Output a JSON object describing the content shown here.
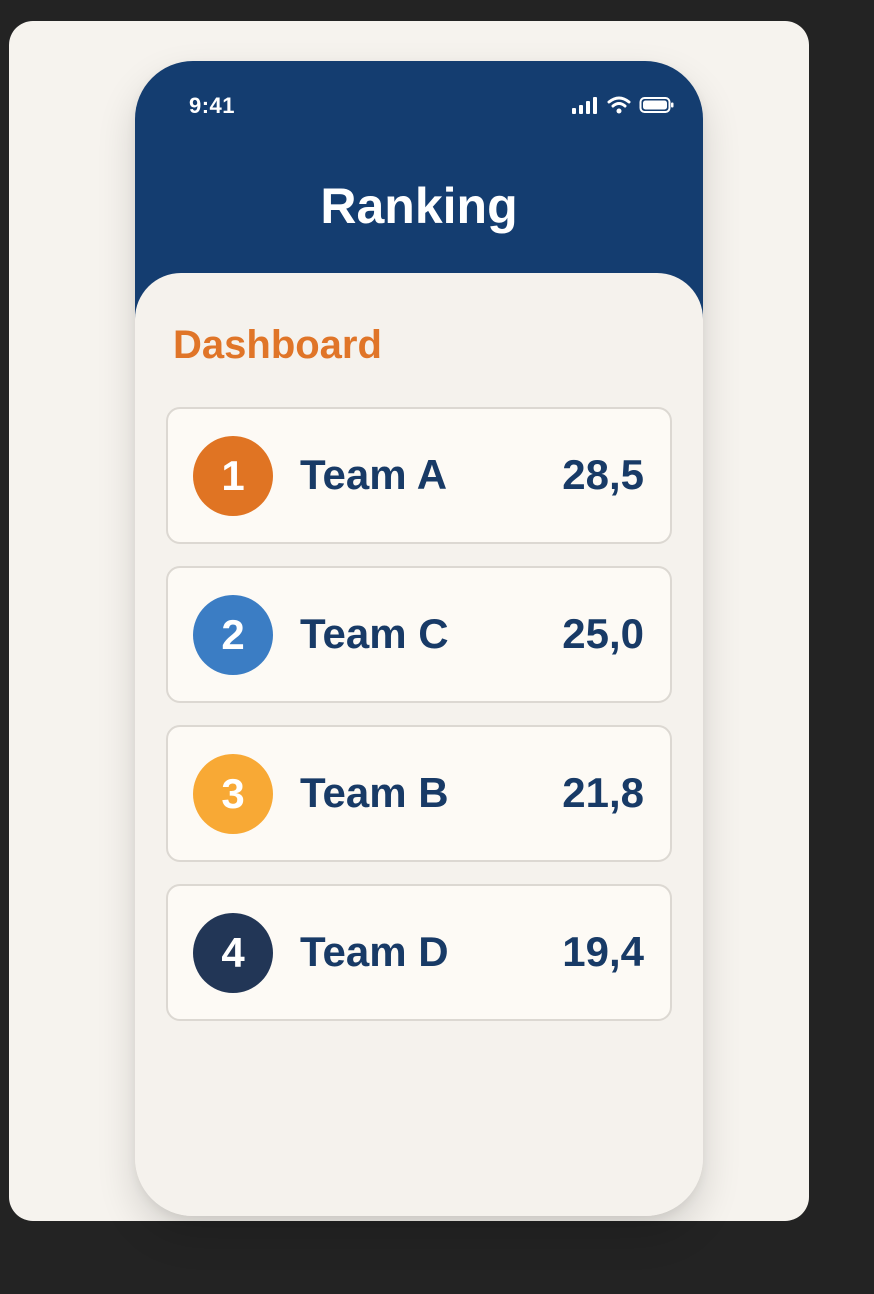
{
  "status_bar": {
    "time": "9:41",
    "signal_icon": "cellular-signal-icon",
    "wifi_icon": "wifi-icon",
    "battery_icon": "battery-icon"
  },
  "header": {
    "title": "Ranking",
    "background_color": "#143d70"
  },
  "section": {
    "label": "Dashboard",
    "label_color": "#e07528"
  },
  "rankings": [
    {
      "rank": "1",
      "team": "Team A",
      "score": "28,5",
      "badge_color": "#e07423"
    },
    {
      "rank": "2",
      "team": "Team C",
      "score": "25,0",
      "badge_color": "#3b7dc4"
    },
    {
      "rank": "3",
      "team": "Team B",
      "score": "21,8",
      "badge_color": "#f8a935"
    },
    {
      "rank": "4",
      "team": "Team D",
      "score": "19,4",
      "badge_color": "#223656"
    }
  ]
}
